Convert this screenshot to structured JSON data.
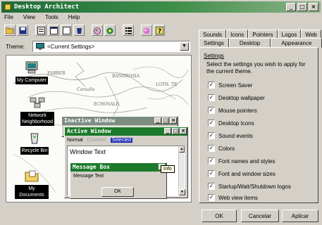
{
  "window": {
    "title": "Desktop Architect"
  },
  "titlebar_buttons": [
    "_",
    "□",
    "×"
  ],
  "menu": [
    "File",
    "View",
    "Tools",
    "Help"
  ],
  "toolbar": {
    "icons": [
      "folder-open-icon",
      "save-icon",
      "properties-icon",
      "theme-icon",
      "window-icon",
      "recycle-icon",
      "color-icon",
      "effects-icon",
      "list-icon",
      "paint-icon",
      "help-icon"
    ]
  },
  "theme": {
    "label": "Theme:",
    "selected": "<Current Settings>"
  },
  "desktop_icons": [
    "My Computer",
    "Network Neighborhood",
    "Recycle Bin",
    "My Documents"
  ],
  "map_labels": [
    "FABBER",
    "BANDROSIA",
    "LOTH. TE",
    "Caraalia",
    "ECHOSALE"
  ],
  "inactive_window": {
    "title": "Inactive Window"
  },
  "active_window": {
    "title": "Active Window"
  },
  "menu_sample": {
    "normal": "Normal",
    "disabled": "Disabled",
    "selected": "Selected"
  },
  "window_text": "Window Text",
  "message_box": {
    "title": "Message Box",
    "text": "Message Text",
    "ok": "OK"
  },
  "tooltip": "Info",
  "tabs_back": [
    "Sounds",
    "Icons",
    "Pointers",
    "Logos",
    "Web"
  ],
  "tabs_front": [
    "Settings",
    "Desktop",
    "Appearance"
  ],
  "settings": {
    "group_label": "Settings",
    "description": "Select the settings you wish to apply for the current theme.",
    "items": [
      "Screen Saver",
      "Desktop wallpaper",
      "Mouse pointers",
      "Desktop Icons",
      "Sound events",
      "Colors",
      "Font names and styles",
      "Font and window sizes",
      "Startup/Wait/Shutdown logos",
      "Web view items"
    ],
    "checked_mark": "✓"
  },
  "buttons": {
    "ok": "OK",
    "cancel": "Cancelar",
    "apply": "Aplicar"
  },
  "colors": {
    "titlebar_start": "#1f6b3a",
    "titlebar_end": "#8fb28a",
    "active_title": "#1c7a2b",
    "inactive_title": "#7c8c80",
    "selection": "#1c2db4"
  }
}
